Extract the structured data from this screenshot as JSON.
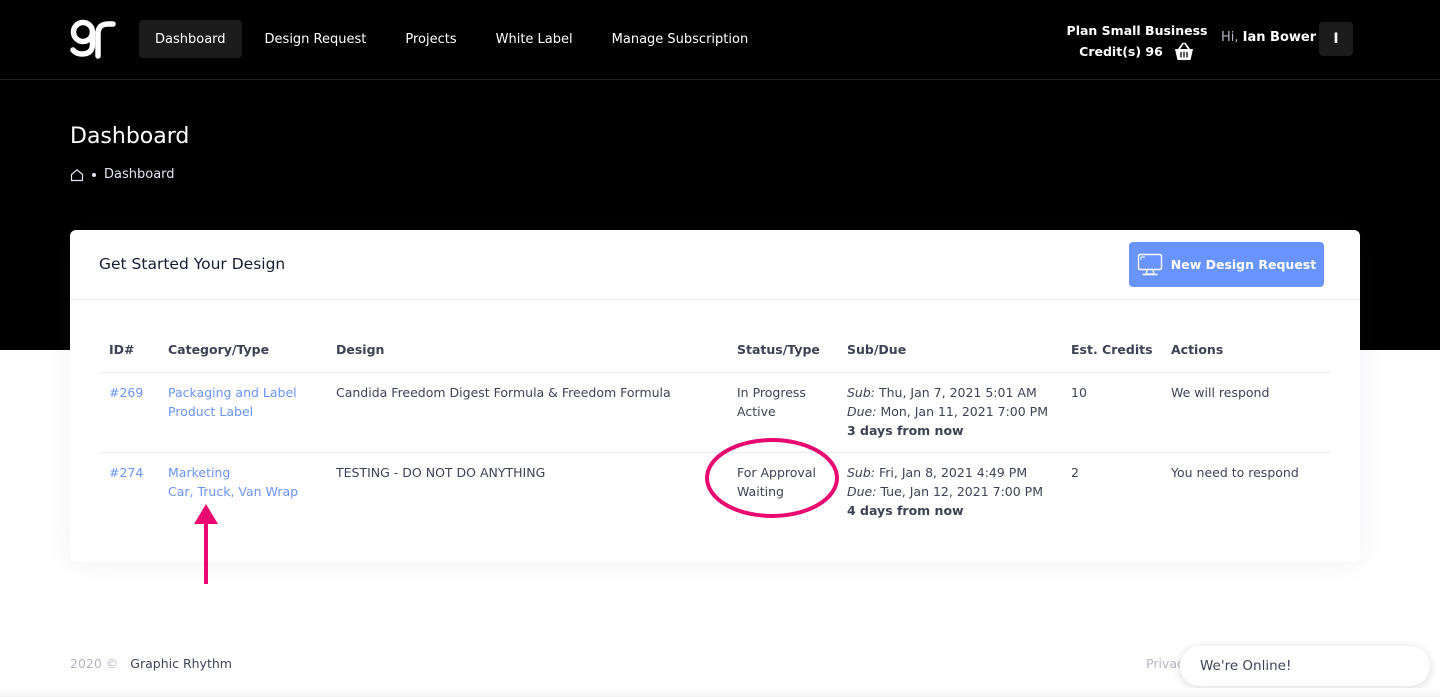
{
  "header": {
    "nav": [
      {
        "label": "Dashboard",
        "active": true
      },
      {
        "label": "Design Request",
        "active": false
      },
      {
        "label": "Projects",
        "active": false
      },
      {
        "label": "White Label",
        "active": false
      },
      {
        "label": "Manage Subscription",
        "active": false
      }
    ],
    "plan_label": "Plan Small Business",
    "credits_label": "Credit(s) 96",
    "greeting_hi": "Hi,",
    "user_name": "Ian Bower",
    "avatar_initial": "I",
    "icons": {
      "logo": "graphic-rhythm-logo",
      "cart": "basket-icon"
    }
  },
  "page": {
    "title": "Dashboard",
    "breadcrumb": {
      "home_icon": "home-icon",
      "current": "Dashboard"
    }
  },
  "card": {
    "title": "Get Started Your Design",
    "new_request_label": "New Design Request",
    "new_request_icon": "monitor-icon",
    "columns": [
      "ID#",
      "Category/Type",
      "Design",
      "Status/Type",
      "Sub/Due",
      "Est. Credits",
      "Actions"
    ],
    "rows": [
      {
        "id": "#269",
        "category": "Packaging and Label",
        "type": "Product Label",
        "design": "Candida Freedom Digest Formula & Freedom Formula",
        "status": "In Progress",
        "status_type": "Active",
        "sub_label": "Sub:",
        "sub_date": "Thu, Jan 7, 2021 5:01 AM",
        "due_label": "Due:",
        "due_date": "Mon, Jan 11, 2021 7:00 PM",
        "relative": "3 days from now",
        "credits": "10",
        "action": "We will respond"
      },
      {
        "id": "#274",
        "category": "Marketing",
        "type": "Car, Truck, Van Wrap",
        "design": "TESTING - DO NOT DO ANYTHING",
        "status": "For Approval",
        "status_type": "Waiting",
        "sub_label": "Sub:",
        "sub_date": "Fri, Jan 8, 2021 4:49 PM",
        "due_label": "Due:",
        "due_date": "Tue, Jan 12, 2021 7:00 PM",
        "relative": "4 days from now",
        "credits": "2",
        "action": "You need to respond"
      }
    ]
  },
  "annotations": {
    "color": "#e8086f"
  },
  "footer": {
    "year": "2020 ©",
    "brand": "Graphic Rhythm",
    "right_partial": "Privac",
    "chat_label": "We're Online!"
  },
  "colors": {
    "accent": "#6993ff",
    "dark": "#000000",
    "annotation": "#e8086f"
  }
}
